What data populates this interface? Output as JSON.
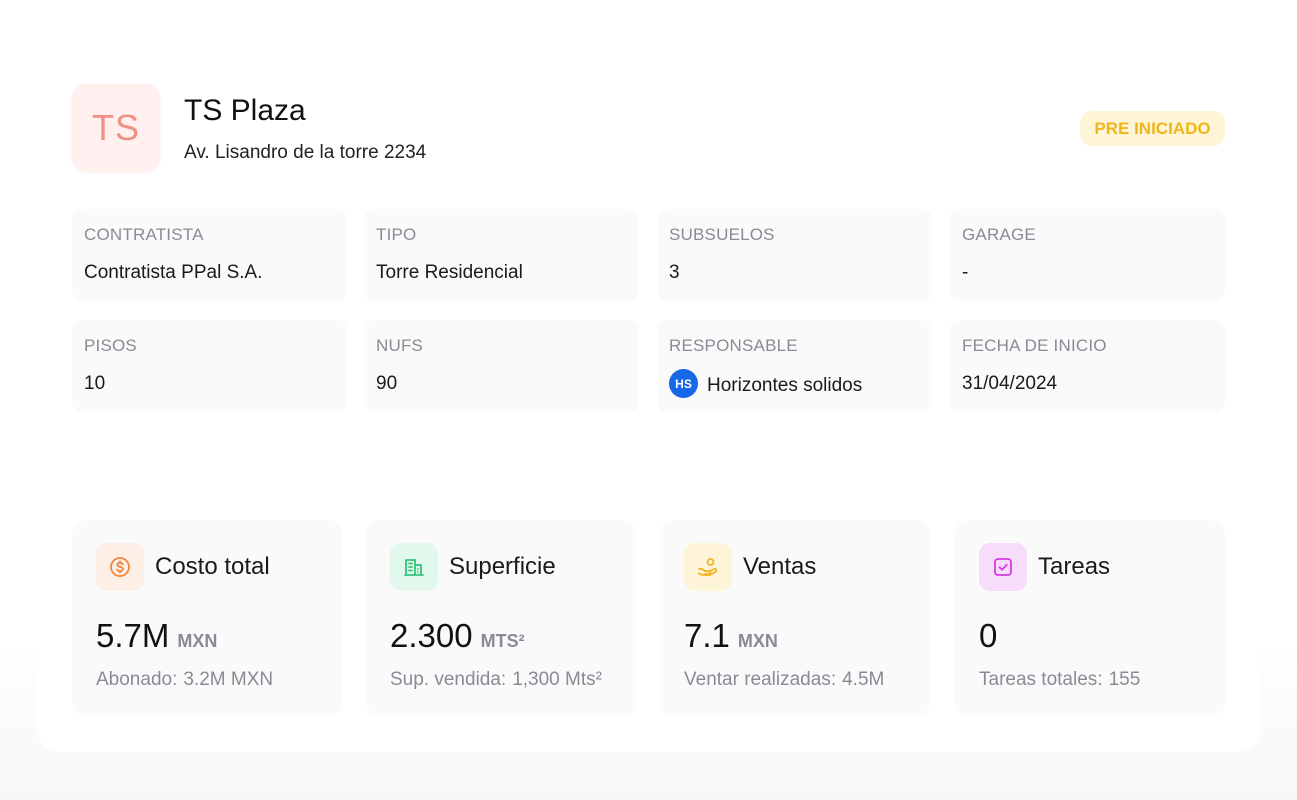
{
  "project": {
    "initials": "TS",
    "name": "TS Plaza",
    "address": "Av. Lisandro de la torre 2234",
    "status": "PRE INICIADO"
  },
  "info": [
    {
      "label": "CONTRATISTA",
      "value": "Contratista PPal S.A."
    },
    {
      "label": "TIPO",
      "value": "Torre Residencial"
    },
    {
      "label": "SUBSUELOS",
      "value": "3"
    },
    {
      "label": "GARAGE",
      "value": "-"
    },
    {
      "label": "PISOS",
      "value": "10"
    },
    {
      "label": "NUFS",
      "value": "90"
    },
    {
      "label": "RESPONSABLE",
      "value": "Horizontes solidos",
      "avatar": "HS"
    },
    {
      "label": "FECHA DE INICIO",
      "value": "31/04/2024"
    }
  ],
  "stats": [
    {
      "title": "Costo total",
      "icon": "dollar-coin-icon",
      "value": "5.7M",
      "unit": "MXN",
      "sub_label": "Abonado:",
      "sub_value": "3.2M MXN",
      "icon_bg": "#fdeee6",
      "icon_color": "#f0873e"
    },
    {
      "title": "Superficie",
      "icon": "building-icon",
      "value": "2.300",
      "unit": "MTS²",
      "sub_label": "Sup. vendida:",
      "sub_value": "1,300 Mts²",
      "icon_bg": "#e3f8ec",
      "icon_color": "#35c37a"
    },
    {
      "title": "Ventas",
      "icon": "hand-coins-icon",
      "value": "7.1",
      "unit": "MXN",
      "sub_label": "Ventar realizadas:",
      "sub_value": "4.5M",
      "icon_bg": "#fef5d8",
      "icon_color": "#f0b323"
    },
    {
      "title": "Tareas",
      "icon": "check-square-icon",
      "value": "0",
      "unit": "",
      "sub_label": "Tareas totales:",
      "sub_value": "155",
      "icon_bg": "#f7dcfb",
      "icon_color": "#d53be0"
    }
  ]
}
